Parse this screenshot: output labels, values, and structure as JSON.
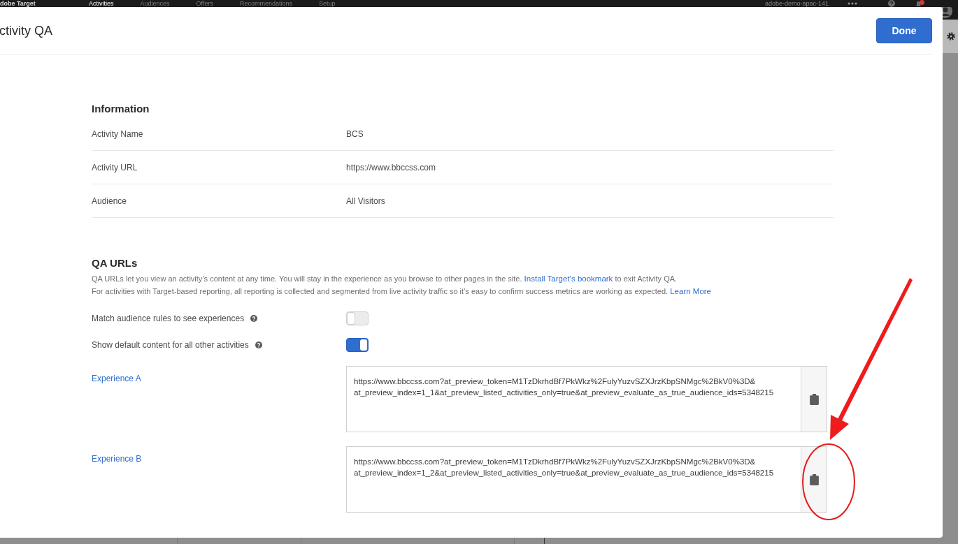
{
  "app_bar": {
    "logo": "dobe Target",
    "nav": [
      {
        "label": "Activities",
        "selected": true
      },
      {
        "label": "Audiences",
        "selected": false
      },
      {
        "label": "Offers",
        "selected": false
      },
      {
        "label": "Recommendations",
        "selected": false
      },
      {
        "label": "Setup",
        "selected": false
      }
    ],
    "account": "adobe-demo-apac-141"
  },
  "dialog": {
    "title": "ctivity QA",
    "done_button": "Done"
  },
  "information": {
    "heading": "Information",
    "rows": [
      {
        "label": "Activity Name",
        "value": "BCS"
      },
      {
        "label": "Activity URL",
        "value": "https://www.bbccss.com"
      },
      {
        "label": "Audience",
        "value": "All Visitors"
      }
    ]
  },
  "qa_urls": {
    "heading": "QA URLs",
    "description": [
      {
        "text": "QA URLs let you view an activity’s content at any time. You will stay in the experience as you browse to other pages in the site.",
        "link": "Install Target’s bookmark",
        "after": "to exit Activity QA."
      },
      {
        "text": "For activities with Target-based reporting, all reporting is collected and segmented from live activity traffic so it’s easy to confirm success metrics are working as expected.",
        "link": "Learn More"
      }
    ],
    "toggles": [
      {
        "label": "Match audience rules to see experiences",
        "on": false
      },
      {
        "label": "Show default content for all other activities",
        "on": true
      }
    ],
    "experiences": [
      {
        "label": "Experience A",
        "url": "https://www.bbccss.com?at_preview_token=M1TzDkrhdBf7PkWkz%2FulyYuzvSZXJrzKbpSNMgc%2BkV0%3D&at_preview_index=1_1&at_preview_listed_activities_only=true&at_preview_evaluate_as_true_audience_ids=5348215"
      },
      {
        "label": "Experience B",
        "url": "https://www.bbccss.com?at_preview_token=M1TzDkrhdBf7PkWkz%2FulyYuzvSZXJrzKbpSNMgc%2BkV0%3D&at_preview_index=1_2&at_preview_listed_activities_only=true&at_preview_evaluate_as_true_audience_ids=5348215"
      }
    ]
  }
}
